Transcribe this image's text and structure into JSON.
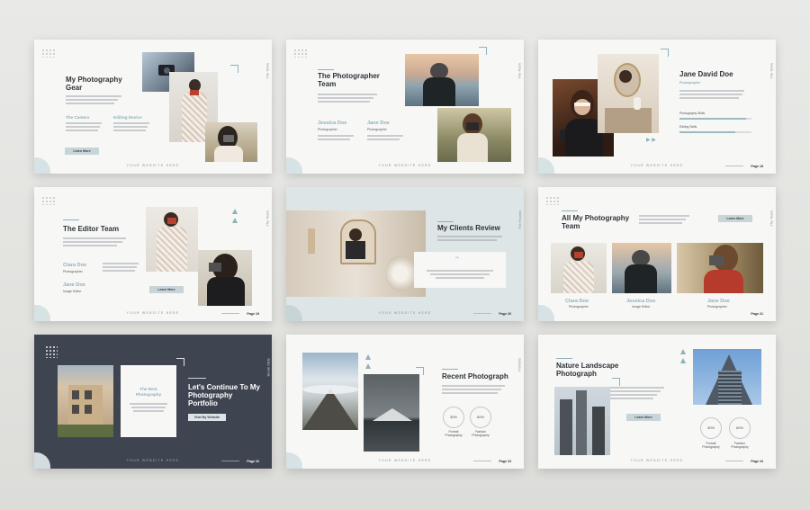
{
  "footer_text": "YOUR WEBSITE HERE",
  "slides": {
    "s1": {
      "title": "My Photography Gear",
      "tab": "The Team",
      "col1": "The Camera",
      "col2": "Editing Device",
      "button": "Learn More"
    },
    "s2": {
      "title": "The Photographer Team",
      "tab": "The Team",
      "name1": "Jessica Doe",
      "role1": "Photographer",
      "name2": "Jane Doe",
      "role2": "Photographer"
    },
    "s3": {
      "title": "Jane David Doe",
      "subtitle": "Photographer",
      "tab": "The Team",
      "skill1": "Photography Skills",
      "skill1_level": 0.92,
      "skill2": "Editing Skills",
      "skill2_level": 0.78,
      "page": "Page 18"
    },
    "s4": {
      "title": "The Editor Team",
      "tab": "The Team",
      "name1": "Clara Doe",
      "role1": "Photographer",
      "name2": "Jane Doe",
      "role2": "Image Editor",
      "button": "Learn More",
      "page": "Page 19"
    },
    "s5": {
      "title": "My Clients Review",
      "tab": "The Review",
      "quote_mark": "““",
      "page": "Page 20"
    },
    "s6": {
      "title": "All My Photography Team",
      "tab": "The Team",
      "button": "Learn More",
      "name1": "Clara Doe",
      "role1": "Photographer",
      "name2": "Jessica Doe",
      "role2": "Image Editor",
      "name3": "Jane Doe",
      "role3": "Photographer",
      "page": "Page 21"
    },
    "s7": {
      "title": "Let's Continue To My Photography Portfolio",
      "card_title": "The Best Photography",
      "tab": "Break Slide",
      "button": "Visit My Website",
      "page": "Page 22"
    },
    "s8": {
      "title": "Recent Photograph",
      "tab": "Portfolio",
      "pct1": "30%",
      "label1": "Portrait Photography",
      "pct2": "60%",
      "label2": "Fashion Photography",
      "page": "Page 23"
    },
    "s9": {
      "title": "Nature Landscape Photograph",
      "button": "Learn More",
      "pct1": "30%",
      "label1": "Portrait Photography",
      "pct2": "60%",
      "label2": "Fashion Photography",
      "page": "Page 24"
    }
  }
}
